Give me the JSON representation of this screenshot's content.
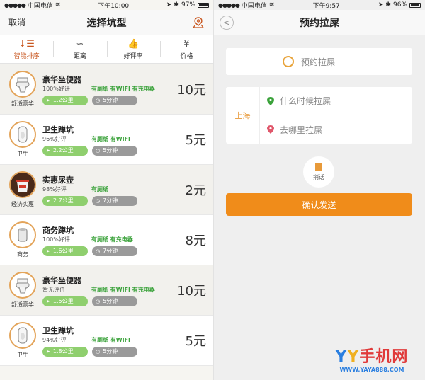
{
  "left": {
    "status": {
      "carrier": "中国电信",
      "time": "下午10:00",
      "battery": "97%"
    },
    "nav": {
      "cancel": "取消",
      "title": "选择坑型"
    },
    "sort": [
      {
        "icon": "↓☰",
        "label": "智能排序"
      },
      {
        "icon": "∽",
        "label": "距离"
      },
      {
        "icon": "👍",
        "label": "好评率"
      },
      {
        "icon": "¥",
        "label": "价格"
      }
    ],
    "items": [
      {
        "name": "豪华坐便器",
        "rating": "100%好评",
        "features": "有厕纸 有WIFI 有充电器",
        "distance": "1.2公里",
        "time": "5分钟",
        "price": "10元",
        "type": "舒适豪华",
        "kind": "toilet"
      },
      {
        "name": "卫生蹲坑",
        "rating": "96%好评",
        "features": "有厕纸 有WIFI",
        "distance": "2.2公里",
        "time": "5分钟",
        "price": "5元",
        "type": "卫生",
        "kind": "squat"
      },
      {
        "name": "实惠尿壶",
        "rating": "98%好评",
        "features": "有厕纸",
        "distance": "2.7公里",
        "time": "7分钟",
        "price": "2元",
        "type": "经济实惠",
        "kind": "pot"
      },
      {
        "name": "商务蹲坑",
        "rating": "100%好评",
        "features": "有厕纸 有充电器",
        "distance": "1.6公里",
        "time": "7分钟",
        "price": "8元",
        "type": "商务",
        "kind": "roll"
      },
      {
        "name": "豪华坐便器",
        "rating": "暂无评价",
        "features": "有厕纸 有WIFI 有充电器",
        "distance": "1.5公里",
        "time": "5分钟",
        "price": "10元",
        "type": "舒适豪华",
        "kind": "toilet"
      },
      {
        "name": "卫生蹲坑",
        "rating": "94%好评",
        "features": "有厕纸 有WIFI",
        "distance": "1.8公里",
        "time": "5分钟",
        "price": "5元",
        "type": "卫生",
        "kind": "squat"
      }
    ]
  },
  "right": {
    "status": {
      "carrier": "中国电信",
      "time": "下午9:57",
      "battery": "96%"
    },
    "nav": {
      "back": "<",
      "title": "预约拉屎"
    },
    "reserve": "预约拉屎",
    "city": "上海",
    "when_placeholder": "什么时候拉屎",
    "where_placeholder": "去哪里拉屎",
    "message_label": "捎话",
    "confirm": "确认发送",
    "watermark": {
      "main": "YY手机网",
      "sub": "WWW.YAYA888.COM"
    }
  },
  "colors": {
    "accent": "#f08c1a",
    "feature_green": "#3aa23a",
    "distance_pill": "#8fcf6e",
    "time_pill": "#9a9a9a"
  }
}
